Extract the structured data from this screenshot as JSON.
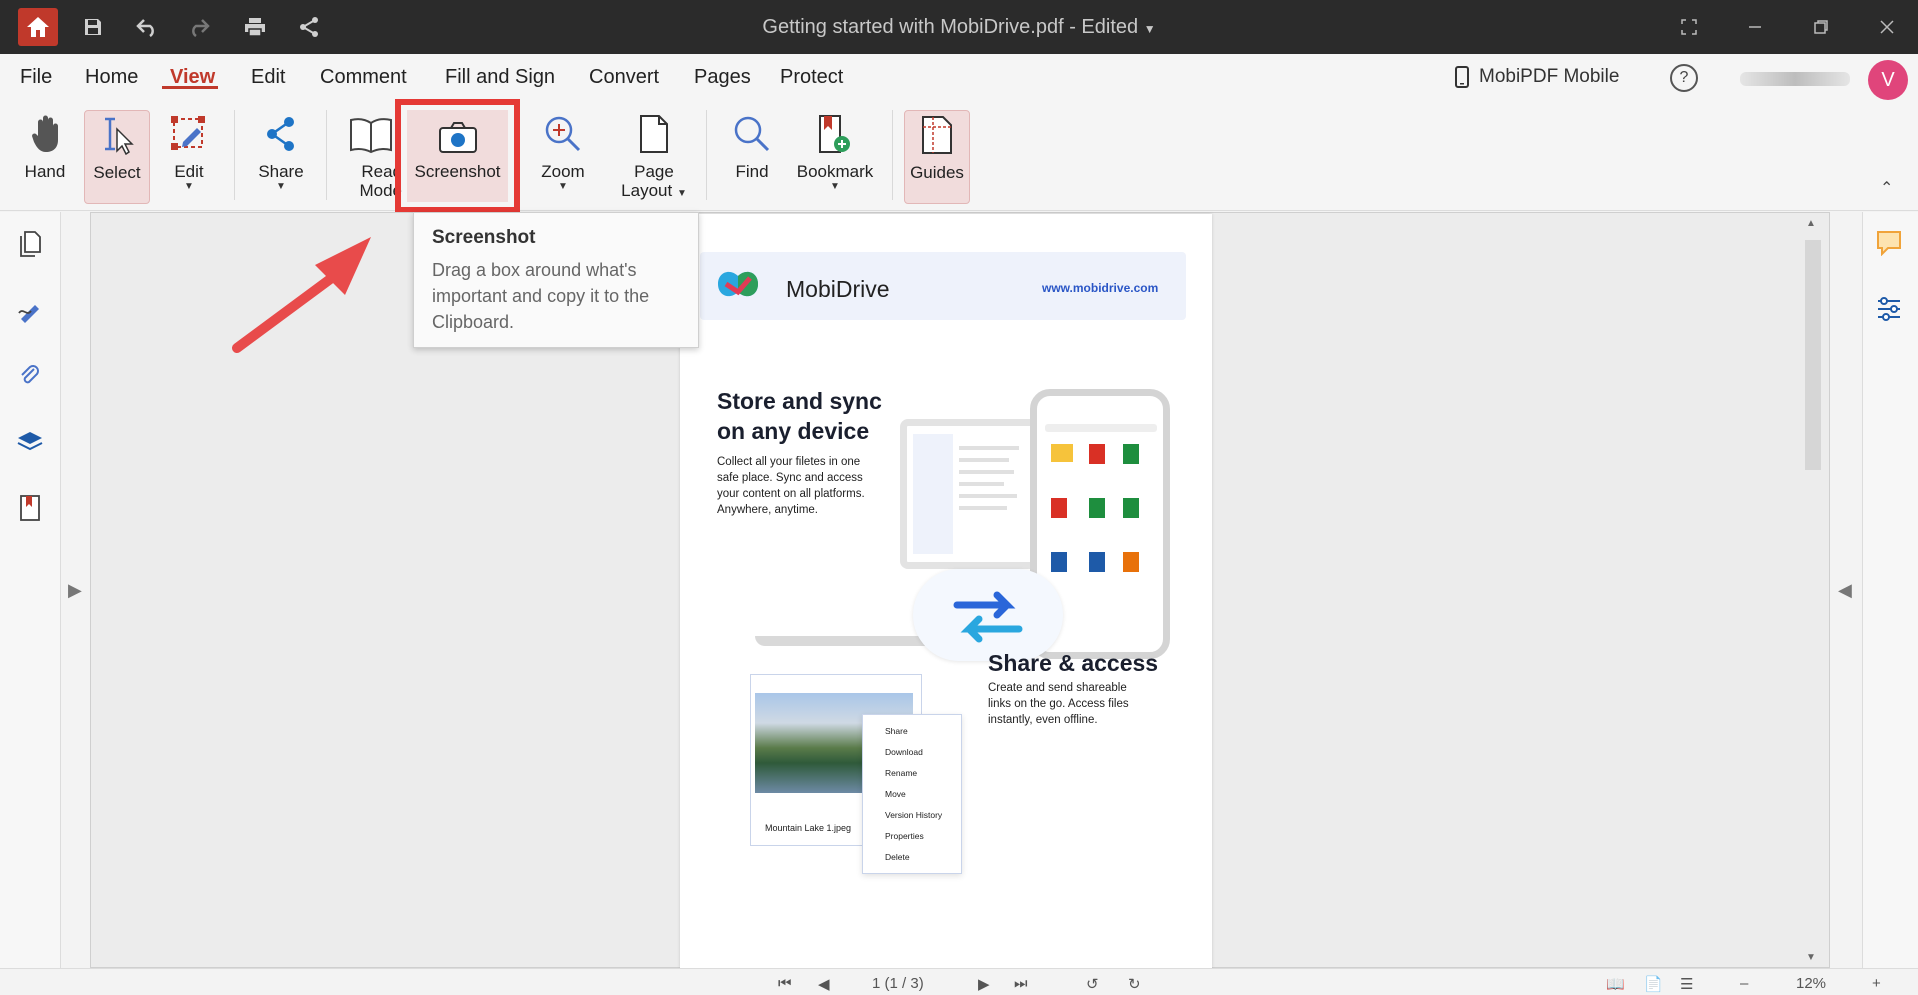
{
  "window": {
    "title": "Getting started with MobiDrive.pdf - Edited"
  },
  "menu": {
    "items": [
      "File",
      "Home",
      "View",
      "Edit",
      "Comment",
      "Fill and Sign",
      "Convert",
      "Pages",
      "Protect"
    ],
    "active": "View",
    "mobile_label": "MobiPDF Mobile",
    "help_label": "?",
    "avatar_initial": "V"
  },
  "ribbon": {
    "hand": "Hand",
    "select": "Select",
    "edit": "Edit",
    "share": "Share",
    "read_mode_1": "Read",
    "read_mode_2": "Mode",
    "screenshot": "Screenshot",
    "zoom": "Zoom",
    "page_layout_1": "Page",
    "page_layout_2": "Layout",
    "find": "Find",
    "bookmark": "Bookmark",
    "guides": "Guides"
  },
  "tooltip": {
    "title": "Screenshot",
    "line1": "Drag a box around what's",
    "line2": "important and copy it to the",
    "line3": "Clipboard."
  },
  "document": {
    "brand_name": "MobiDrive",
    "brand_url": "www.mobidrive.com",
    "heading1_line1": "Store and sync",
    "heading1_line2": "on any device",
    "para1_line1": "Collect all your filetes in one",
    "para1_line2": "safe place. Sync and access",
    "para1_line3": "your content on all platforms.",
    "para1_line4": "Anywhere, anytime.",
    "heading2": "Share & access",
    "para2_line1": "Create and send shareable",
    "para2_line2": "links on the go. Access files",
    "para2_line3": "instantly, even offline.",
    "photo_caption": "Mountain Lake 1.jpeg",
    "context_menu": [
      "Share",
      "Download",
      "Rename",
      "Move",
      "Version History",
      "Properties",
      "Delete"
    ]
  },
  "status": {
    "page_indicator": "1 (1 / 3)",
    "zoom": "12%",
    "minus": "–",
    "plus": "+"
  },
  "colors": {
    "accent": "#c0392b",
    "highlight": "#e53935",
    "brand_blue": "#2a56c6"
  }
}
